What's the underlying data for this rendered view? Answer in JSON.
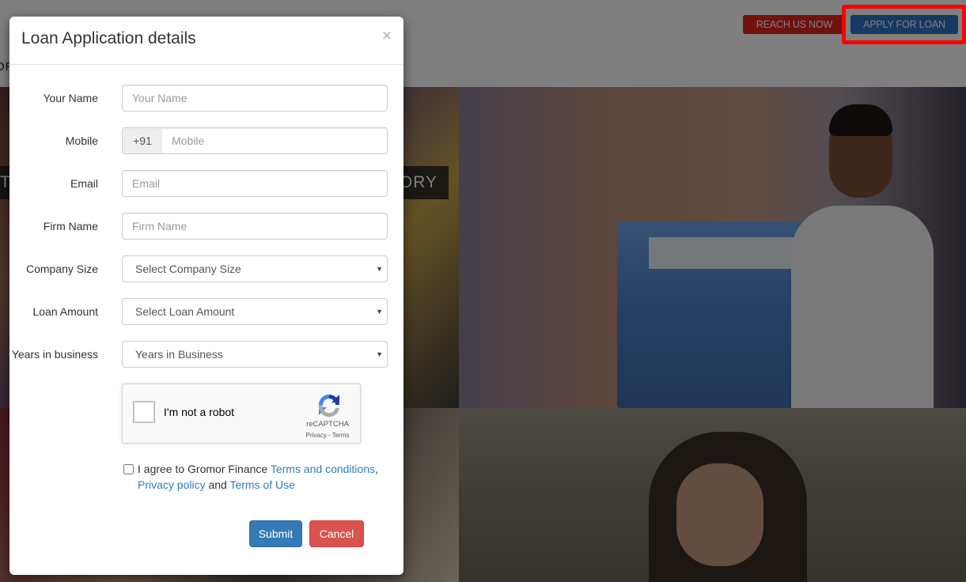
{
  "header": {
    "nav_fragment": "OF",
    "reach_button": "REACH US NOW",
    "apply_button": "APPLY FOR LOAN"
  },
  "background": {
    "banner_left": "TI",
    "banner_right": "TORY"
  },
  "modal": {
    "title": "Loan Application details",
    "close_label": "×",
    "fields": {
      "name": {
        "label": "Your Name",
        "placeholder": "Your Name",
        "value": ""
      },
      "mobile": {
        "label": "Mobile",
        "prefix": "+91",
        "placeholder": "Mobile",
        "value": ""
      },
      "email": {
        "label": "Email",
        "placeholder": "Email",
        "value": ""
      },
      "firm": {
        "label": "Firm Name",
        "placeholder": "Firm Name",
        "value": ""
      },
      "company_size": {
        "label": "Company Size",
        "selected": "Select Company Size"
      },
      "loan_amount": {
        "label": "Loan Amount",
        "selected": "Select Loan Amount"
      },
      "years": {
        "label": "Years in business",
        "selected": "Years in Business"
      }
    },
    "recaptcha": {
      "label": "I'm not a robot",
      "brand": "reCAPTCHA",
      "links": "Privacy - Terms",
      "checked": false
    },
    "agreement": {
      "checked": false,
      "prefix": "I agree to Gromor Finance ",
      "terms_link": "Terms and conditions",
      "comma": ",",
      "privacy_link": "Privacy policy",
      "and": " and ",
      "use_link": "Terms of Use"
    },
    "submit_label": "Submit",
    "cancel_label": "Cancel"
  },
  "colors": {
    "primary": "#337ab7",
    "danger": "#d9534f",
    "highlight": "#ff0000"
  }
}
